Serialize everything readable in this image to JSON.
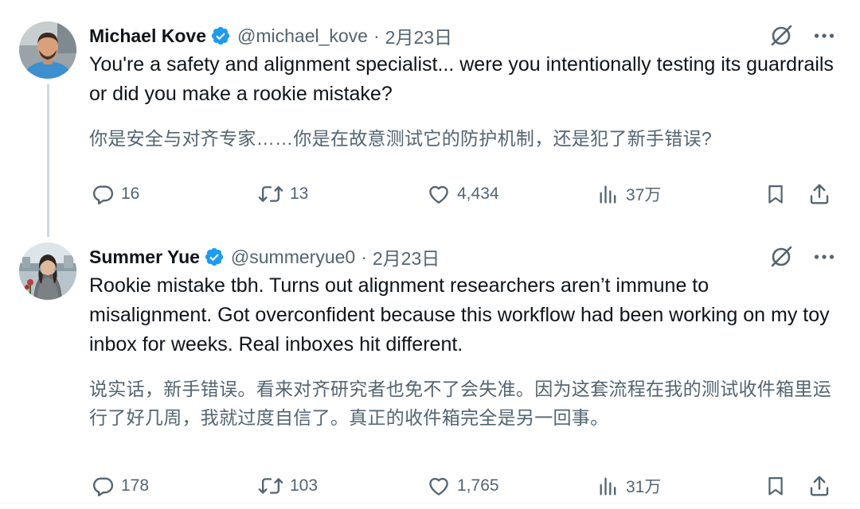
{
  "colors": {
    "text": "#0f1419",
    "secondary": "#536471",
    "verified": "#1d9bf0",
    "thread_line": "#cfd9de"
  },
  "tweets": [
    {
      "author_name": "Michael Kove",
      "verified": true,
      "handle": "@michael_kove",
      "separator": "·",
      "date": "2月23日",
      "text_en": "You're a safety and alignment specialist... were you intentionally testing its guardrails or did you make a rookie mistake?",
      "text_zh": "你是安全与对齐专家……你是在故意测试它的防护机制，还是犯了新手错误?",
      "stats": {
        "replies": "16",
        "reposts": "13",
        "likes": "4,434",
        "views": "37万"
      },
      "icons": [
        "grok-icon",
        "more-icon",
        "reply-icon",
        "repost-icon",
        "like-icon",
        "views-icon",
        "bookmark-icon",
        "share-icon"
      ]
    },
    {
      "author_name": "Summer Yue",
      "verified": true,
      "handle": "@summeryue0",
      "separator": "·",
      "date": "2月23日",
      "text_en": "Rookie mistake tbh. Turns out alignment researchers aren’t immune to misalignment. Got overconfident because this workflow had been working on my toy inbox for weeks. Real inboxes hit different.",
      "text_zh": "说实话，新手错误。看来对齐研究者也免不了会失准。因为这套流程在我的测试收件箱里运行了好几周，我就过度自信了。真正的收件箱完全是另一回事。",
      "stats": {
        "replies": "178",
        "reposts": "103",
        "likes": "1,765",
        "views": "31万"
      },
      "icons": [
        "grok-icon",
        "more-icon",
        "reply-icon",
        "repost-icon",
        "like-icon",
        "views-icon",
        "bookmark-icon",
        "share-icon"
      ]
    }
  ]
}
